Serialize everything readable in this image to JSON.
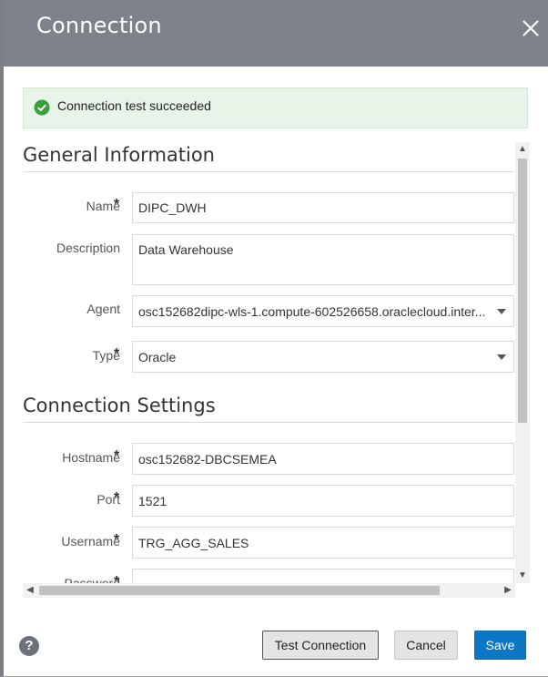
{
  "dialog": {
    "title": "Connection",
    "close_icon": "close-icon"
  },
  "alert": {
    "icon": "checkmark-circle-icon",
    "message": "Connection test succeeded",
    "color": "#3a9e3a"
  },
  "general": {
    "heading": "General Information",
    "name": {
      "label": "Name",
      "required": "*",
      "value": "DIPC_DWH"
    },
    "description": {
      "label": "Description",
      "value": "Data Warehouse"
    },
    "agent": {
      "label": "Agent",
      "value": "osc152682dipc-wls-1.compute-602526658.oraclecloud.inter..."
    },
    "type": {
      "label": "Type",
      "required": "*",
      "value": "Oracle"
    }
  },
  "settings": {
    "heading": "Connection Settings",
    "hostname": {
      "label": "Hostname",
      "required": "*",
      "value": "osc152682-DBCSEMEA"
    },
    "port": {
      "label": "Port",
      "required": "*",
      "value": "1521"
    },
    "username": {
      "label": "Username",
      "required": "*",
      "value": "TRG_AGG_SALES"
    },
    "password": {
      "label": "Password",
      "required": "*",
      "value": "●●●●●●●●●●●"
    }
  },
  "footer": {
    "help_icon": "help-icon",
    "help_glyph": "?",
    "test_label": "Test Connection",
    "cancel_label": "Cancel",
    "save_label": "Save"
  },
  "colors": {
    "header": "#7e838b",
    "primary": "#0b77c5",
    "success_bg": "#e7f4e7"
  }
}
